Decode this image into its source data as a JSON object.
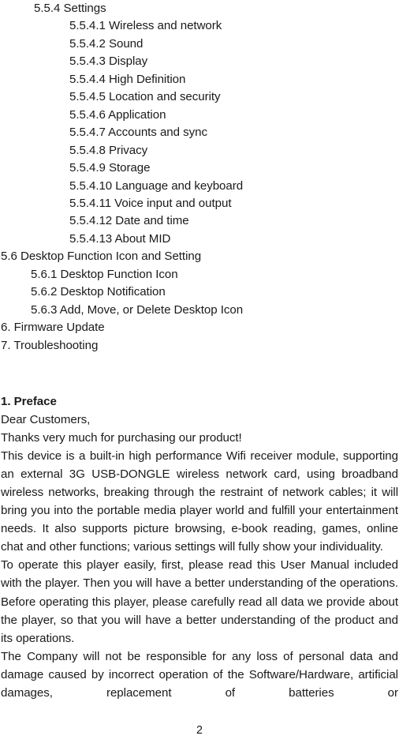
{
  "document": {
    "page_number": "2",
    "toc": {
      "entries": [
        {
          "text": "5.5.4 Settings",
          "level": 2
        },
        {
          "text": "5.5.4.1 Wireless and network",
          "level": 3
        },
        {
          "text": "5.5.4.2 Sound",
          "level": 3
        },
        {
          "text": "5.5.4.3 Display",
          "level": 3
        },
        {
          "text": "5.5.4.4 High Definition",
          "level": 3
        },
        {
          "text": "5.5.4.5 Location and security",
          "level": 3
        },
        {
          "text": "5.5.4.6 Application",
          "level": 3
        },
        {
          "text": "5.5.4.7 Accounts and sync",
          "level": 3
        },
        {
          "text": "5.5.4.8 Privacy",
          "level": 3
        },
        {
          "text": "5.5.4.9 Storage",
          "level": 3
        },
        {
          "text": "5.5.4.10 Language and keyboard",
          "level": 3
        },
        {
          "text": "5.5.4.11 Voice input and output",
          "level": 3
        },
        {
          "text": "5.5.4.12 Date and time",
          "level": 3
        },
        {
          "text": "5.5.4.13 About MID",
          "level": 3
        },
        {
          "text": "5.6 Desktop Function Icon and Setting",
          "level": 0
        },
        {
          "text": "5.6.1 Desktop Function Icon",
          "level": 1
        },
        {
          "text": "5.6.2 Desktop Notification",
          "level": 1
        },
        {
          "text": "5.6.3 Add, Move, or Delete Desktop Icon",
          "level": 1
        },
        {
          "text": "6. Firmware Update",
          "level": 0
        },
        {
          "text": "7. Troubleshooting",
          "level": 0
        }
      ]
    },
    "preface": {
      "heading": "1. Preface",
      "salutation": "Dear Customers,",
      "thanks": "Thanks very much for purchasing our product!",
      "paragraph_1": "This device is a built-in high performance Wifi receiver module, supporting an external 3G USB-DONGLE wireless network card, using broadband wireless networks, breaking through the restraint of network cables; it will bring you into the portable media player world and fulfill your entertainment needs. It also supports picture browsing, e-book reading, games, online chat and other functions; various settings will fully show your individuality.",
      "paragraph_2": "To operate this player easily, first, please read this User Manual included with the player. Then you will have a better understanding of the operations. Before operating this player, please carefully read all data we provide about the player, so that you will have a better understanding of the product and its operations.",
      "paragraph_3": "The Company will not be responsible for any loss of personal data and damage caused by incorrect operation of the Software/Hardware, artificial damages, replacement of batteries or"
    }
  }
}
